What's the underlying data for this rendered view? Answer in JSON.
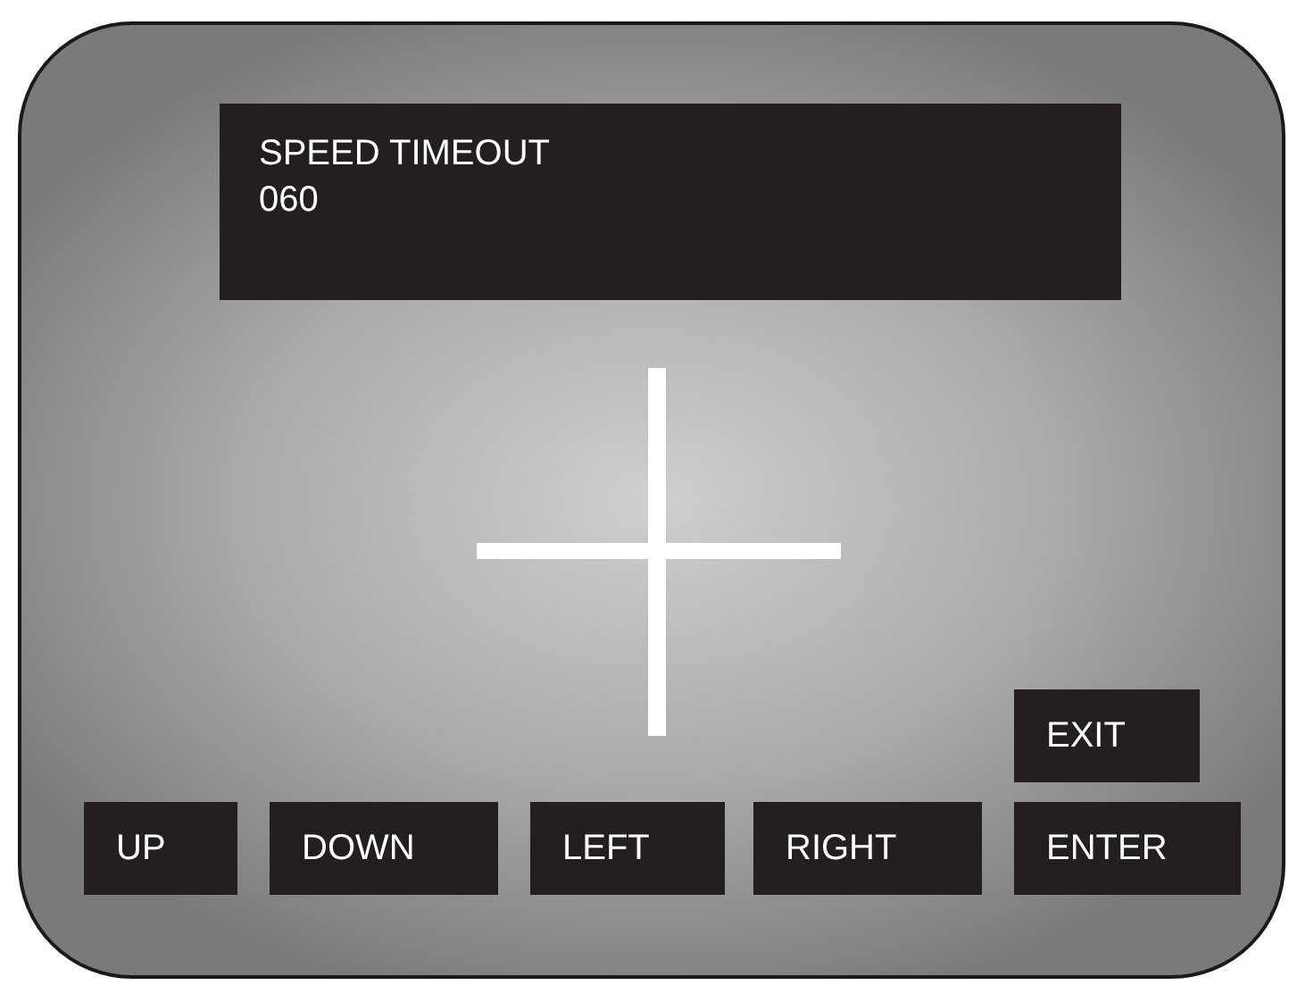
{
  "display": {
    "lines": [
      "SPEED TIMEOUT",
      "060"
    ]
  },
  "exit_button": {
    "label": "EXIT"
  },
  "buttons": [
    {
      "label": "UP"
    },
    {
      "label": "DOWN"
    },
    {
      "label": "LEFT"
    },
    {
      "label": "RIGHT"
    },
    {
      "label": "ENTER"
    }
  ]
}
